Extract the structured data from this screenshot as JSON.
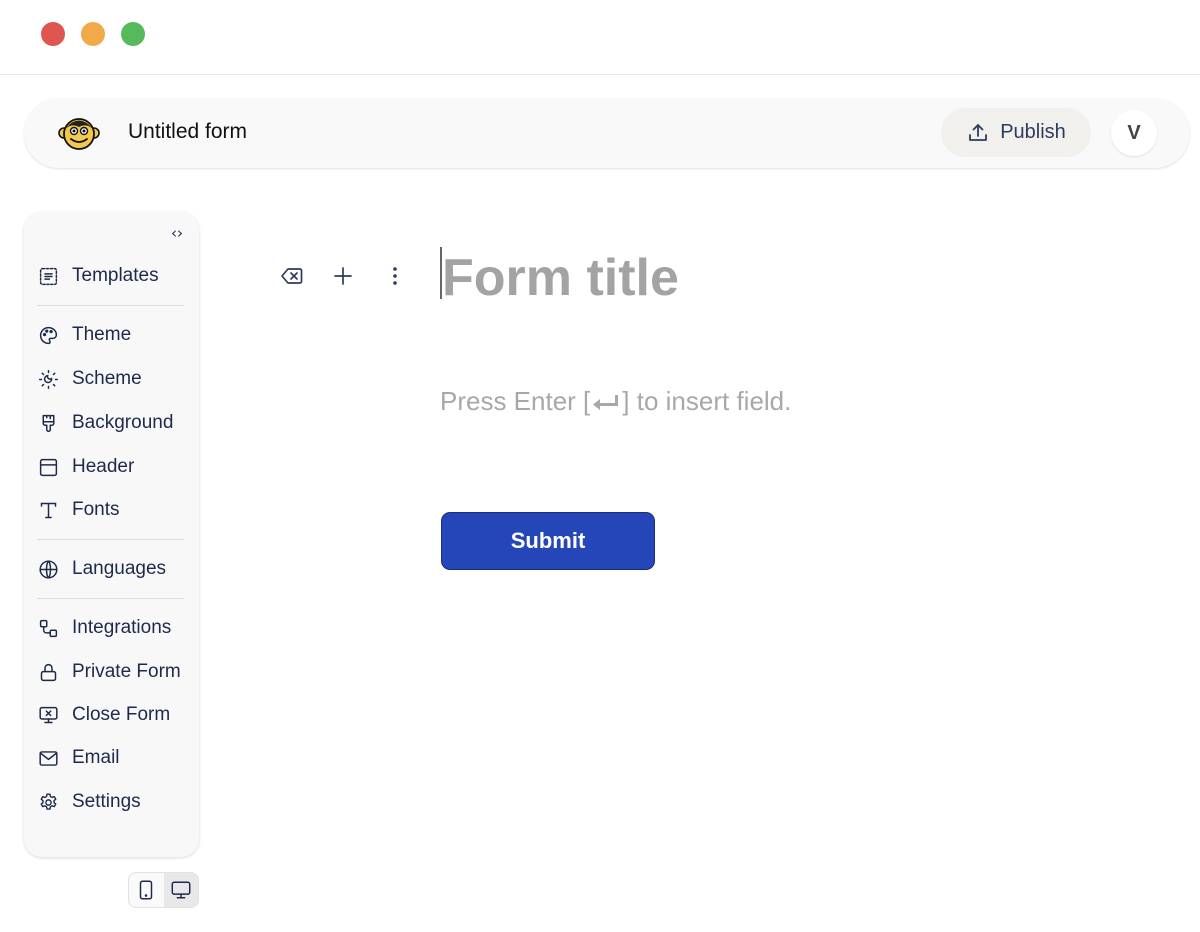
{
  "window": {
    "controls": [
      "close",
      "minimize",
      "maximize"
    ]
  },
  "appbar": {
    "logo": "monkey-logo",
    "form_name": "Untitled form",
    "publish_label": "Publish",
    "publish_icon": "upload-icon",
    "avatar_initial": "V"
  },
  "sidebar": {
    "collapse_glyph": "‹›",
    "items": [
      {
        "label": "Templates",
        "icon": "templates-icon"
      },
      {
        "label": "Theme",
        "icon": "palette-icon"
      },
      {
        "label": "Scheme",
        "icon": "sun-moon-icon"
      },
      {
        "label": "Background",
        "icon": "paintbrush-icon"
      },
      {
        "label": "Header",
        "icon": "panel-top-icon"
      },
      {
        "label": "Fonts",
        "icon": "type-icon"
      },
      {
        "label": "Languages",
        "icon": "globe-icon"
      },
      {
        "label": "Integrations",
        "icon": "workflow-icon"
      },
      {
        "label": "Private Form",
        "icon": "lock-icon"
      },
      {
        "label": "Close Form",
        "icon": "monitor-x-icon"
      },
      {
        "label": "Email",
        "icon": "mail-icon"
      },
      {
        "label": "Settings",
        "icon": "gear-icon"
      }
    ]
  },
  "device_toggle": {
    "options": [
      "mobile",
      "desktop"
    ],
    "active": "desktop"
  },
  "editor": {
    "toolbar": [
      "delete",
      "add",
      "more"
    ],
    "title_placeholder": "Form title",
    "hint_before": "Press Enter [",
    "hint_after": "] to insert field.",
    "submit_label": "Submit"
  },
  "colors": {
    "submit_bg": "#2446b8",
    "text_primary": "#1e2a4a",
    "placeholder": "#a3a3a3"
  }
}
